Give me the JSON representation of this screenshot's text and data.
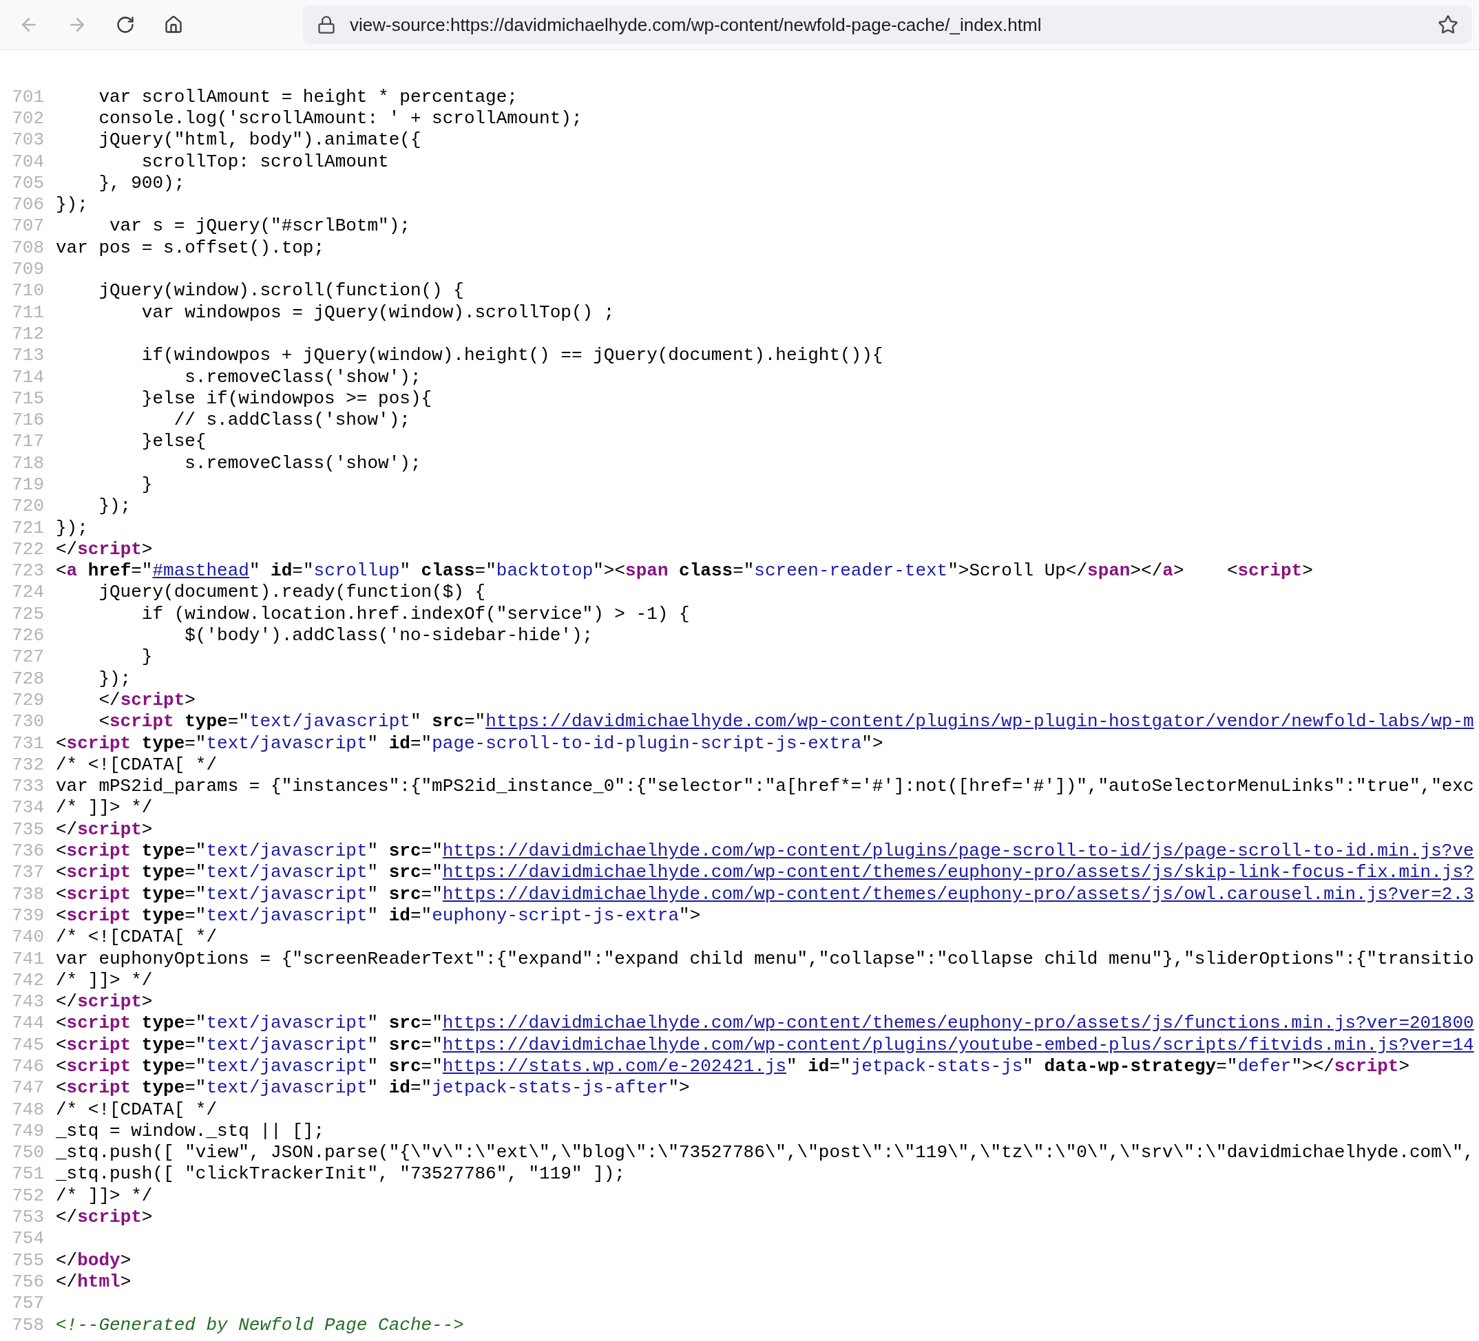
{
  "toolbar": {
    "buttons": [
      {
        "kind": "back",
        "disabled": true
      },
      {
        "kind": "forward",
        "disabled": true
      },
      {
        "kind": "reload",
        "disabled": false
      },
      {
        "kind": "home",
        "disabled": false
      }
    ],
    "address": "view-source:https://davidmichaelhyde.com/wp-content/newfold-page-cache/_index.html"
  },
  "lines": [
    {
      "number": "701",
      "text": "    var scrollAmount = height * percentage;"
    },
    {
      "number": "702",
      "text": "    console.log('scrollAmount: ' + scrollAmount);"
    },
    {
      "number": "703",
      "text": "    jQuery(\"html, body\").animate({"
    },
    {
      "number": "704",
      "text": "        scrollTop: scrollAmount"
    },
    {
      "number": "705",
      "text": "    }, 900);"
    },
    {
      "number": "706",
      "text": "});"
    },
    {
      "number": "707",
      "text": "     var s = jQuery(\"#scrlBotm\");"
    },
    {
      "number": "708",
      "text": "var pos = s.offset().top;"
    },
    {
      "number": "709"
    },
    {
      "number": "710",
      "text": "    jQuery(window).scroll(function() {"
    },
    {
      "number": "711",
      "text": "        var windowpos = jQuery(window).scrollTop() ;"
    },
    {
      "number": "712"
    },
    {
      "number": "713",
      "text": "        if(windowpos + jQuery(window).height() == jQuery(document).height()){"
    },
    {
      "number": "714",
      "text": "            s.removeClass('show');"
    },
    {
      "number": "715",
      "text": "        }else if(windowpos >= pos){"
    },
    {
      "number": "716",
      "text": "           // s.addClass('show');"
    },
    {
      "number": "717",
      "text": "        }else{"
    },
    {
      "number": "718",
      "text": "            s.removeClass('show');"
    },
    {
      "number": "719",
      "text": "        }"
    },
    {
      "number": "720",
      "text": "    });"
    },
    {
      "number": "721",
      "text": "});"
    },
    {
      "number": "722",
      "tokens": [
        {
          "kind": "text",
          "text": "</"
        },
        {
          "kind": "tag",
          "text": "script"
        },
        {
          "kind": "text",
          "text": ">"
        }
      ]
    },
    {
      "number": "723",
      "tokens": [
        {
          "kind": "text",
          "text": "<"
        },
        {
          "kind": "tag",
          "text": "a"
        },
        {
          "kind": "attr",
          "text": " href"
        },
        {
          "kind": "text",
          "text": "=\""
        },
        {
          "kind": "link",
          "text": "#masthead"
        },
        {
          "kind": "text",
          "text": "\" "
        },
        {
          "kind": "attr",
          "text": "id"
        },
        {
          "kind": "text",
          "text": "=\""
        },
        {
          "kind": "value",
          "text": "scrollup"
        },
        {
          "kind": "text",
          "text": "\" "
        },
        {
          "kind": "attr",
          "text": "class"
        },
        {
          "kind": "text",
          "text": "=\""
        },
        {
          "kind": "value",
          "text": "backtotop"
        },
        {
          "kind": "text",
          "text": "\"><"
        },
        {
          "kind": "tag",
          "text": "span"
        },
        {
          "kind": "attr",
          "text": " class"
        },
        {
          "kind": "text",
          "text": "=\""
        },
        {
          "kind": "value",
          "text": "screen-reader-text"
        },
        {
          "kind": "text",
          "text": "\">Scroll Up</"
        },
        {
          "kind": "tag",
          "text": "span"
        },
        {
          "kind": "text",
          "text": "></"
        },
        {
          "kind": "tag",
          "text": "a"
        },
        {
          "kind": "text",
          "text": ">    <"
        },
        {
          "kind": "tag",
          "text": "script"
        },
        {
          "kind": "text",
          "text": ">"
        }
      ]
    },
    {
      "number": "724",
      "text": "    jQuery(document).ready(function($) {"
    },
    {
      "number": "725",
      "text": "        if (window.location.href.indexOf(\"service\") > -1) {"
    },
    {
      "number": "726",
      "text": "            $('body').addClass('no-sidebar-hide');"
    },
    {
      "number": "727",
      "text": "        }"
    },
    {
      "number": "728",
      "text": "    });"
    },
    {
      "number": "729",
      "tokens": [
        {
          "kind": "text",
          "text": "    </"
        },
        {
          "kind": "tag",
          "text": "script"
        },
        {
          "kind": "text",
          "text": ">"
        }
      ]
    },
    {
      "number": "730",
      "tokens": [
        {
          "kind": "text",
          "text": "    <"
        },
        {
          "kind": "tag",
          "text": "script"
        },
        {
          "kind": "attr",
          "text": " type"
        },
        {
          "kind": "text",
          "text": "=\""
        },
        {
          "kind": "value",
          "text": "text/javascript"
        },
        {
          "kind": "text",
          "text": "\" "
        },
        {
          "kind": "attr",
          "text": "src"
        },
        {
          "kind": "text",
          "text": "=\""
        },
        {
          "kind": "link",
          "text": "https://davidmichaelhyde.com/wp-content/plugins/wp-plugin-hostgator/vendor/newfold-labs/wp-m"
        }
      ]
    },
    {
      "number": "731",
      "tokens": [
        {
          "kind": "text",
          "text": "<"
        },
        {
          "kind": "tag",
          "text": "script"
        },
        {
          "kind": "attr",
          "text": " type"
        },
        {
          "kind": "text",
          "text": "=\""
        },
        {
          "kind": "value",
          "text": "text/javascript"
        },
        {
          "kind": "text",
          "text": "\" "
        },
        {
          "kind": "attr",
          "text": "id"
        },
        {
          "kind": "text",
          "text": "=\""
        },
        {
          "kind": "value",
          "text": "page-scroll-to-id-plugin-script-js-extra"
        },
        {
          "kind": "text",
          "text": "\">"
        }
      ]
    },
    {
      "number": "732",
      "text": "/* <![CDATA[ */"
    },
    {
      "number": "733",
      "text": "var mPS2id_params = {\"instances\":{\"mPS2id_instance_0\":{\"selector\":\"a[href*='#']:not([href='#'])\",\"autoSelectorMenuLinks\":\"true\",\"exc"
    },
    {
      "number": "734",
      "text": "/* ]]> */"
    },
    {
      "number": "735",
      "tokens": [
        {
          "kind": "text",
          "text": "</"
        },
        {
          "kind": "tag",
          "text": "script"
        },
        {
          "kind": "text",
          "text": ">"
        }
      ]
    },
    {
      "number": "736",
      "tokens": [
        {
          "kind": "text",
          "text": "<"
        },
        {
          "kind": "tag",
          "text": "script"
        },
        {
          "kind": "attr",
          "text": " type"
        },
        {
          "kind": "text",
          "text": "=\""
        },
        {
          "kind": "value",
          "text": "text/javascript"
        },
        {
          "kind": "text",
          "text": "\" "
        },
        {
          "kind": "attr",
          "text": "src"
        },
        {
          "kind": "text",
          "text": "=\""
        },
        {
          "kind": "link",
          "text": "https://davidmichaelhyde.com/wp-content/plugins/page-scroll-to-id/js/page-scroll-to-id.min.js?ve"
        }
      ]
    },
    {
      "number": "737",
      "tokens": [
        {
          "kind": "text",
          "text": "<"
        },
        {
          "kind": "tag",
          "text": "script"
        },
        {
          "kind": "attr",
          "text": " type"
        },
        {
          "kind": "text",
          "text": "=\""
        },
        {
          "kind": "value",
          "text": "text/javascript"
        },
        {
          "kind": "text",
          "text": "\" "
        },
        {
          "kind": "attr",
          "text": "src"
        },
        {
          "kind": "text",
          "text": "=\""
        },
        {
          "kind": "link",
          "text": "https://davidmichaelhyde.com/wp-content/themes/euphony-pro/assets/js/skip-link-focus-fix.min.js?"
        }
      ]
    },
    {
      "number": "738",
      "tokens": [
        {
          "kind": "text",
          "text": "<"
        },
        {
          "kind": "tag",
          "text": "script"
        },
        {
          "kind": "attr",
          "text": " type"
        },
        {
          "kind": "text",
          "text": "=\""
        },
        {
          "kind": "value",
          "text": "text/javascript"
        },
        {
          "kind": "text",
          "text": "\" "
        },
        {
          "kind": "attr",
          "text": "src"
        },
        {
          "kind": "text",
          "text": "=\""
        },
        {
          "kind": "link",
          "text": "https://davidmichaelhyde.com/wp-content/themes/euphony-pro/assets/js/owl.carousel.min.js?ver=2.3"
        }
      ]
    },
    {
      "number": "739",
      "tokens": [
        {
          "kind": "text",
          "text": "<"
        },
        {
          "kind": "tag",
          "text": "script"
        },
        {
          "kind": "attr",
          "text": " type"
        },
        {
          "kind": "text",
          "text": "=\""
        },
        {
          "kind": "value",
          "text": "text/javascript"
        },
        {
          "kind": "text",
          "text": "\" "
        },
        {
          "kind": "attr",
          "text": "id"
        },
        {
          "kind": "text",
          "text": "=\""
        },
        {
          "kind": "value",
          "text": "euphony-script-js-extra"
        },
        {
          "kind": "text",
          "text": "\">"
        }
      ]
    },
    {
      "number": "740",
      "text": "/* <![CDATA[ */"
    },
    {
      "number": "741",
      "text": "var euphonyOptions = {\"screenReaderText\":{\"expand\":\"expand child menu\",\"collapse\":\"collapse child menu\"},\"sliderOptions\":{\"transitio"
    },
    {
      "number": "742",
      "text": "/* ]]> */"
    },
    {
      "number": "743",
      "tokens": [
        {
          "kind": "text",
          "text": "</"
        },
        {
          "kind": "tag",
          "text": "script"
        },
        {
          "kind": "text",
          "text": ">"
        }
      ]
    },
    {
      "number": "744",
      "tokens": [
        {
          "kind": "text",
          "text": "<"
        },
        {
          "kind": "tag",
          "text": "script"
        },
        {
          "kind": "attr",
          "text": " type"
        },
        {
          "kind": "text",
          "text": "=\""
        },
        {
          "kind": "value",
          "text": "text/javascript"
        },
        {
          "kind": "text",
          "text": "\" "
        },
        {
          "kind": "attr",
          "text": "src"
        },
        {
          "kind": "text",
          "text": "=\""
        },
        {
          "kind": "link",
          "text": "https://davidmichaelhyde.com/wp-content/themes/euphony-pro/assets/js/functions.min.js?ver=201800"
        }
      ]
    },
    {
      "number": "745",
      "tokens": [
        {
          "kind": "text",
          "text": "<"
        },
        {
          "kind": "tag",
          "text": "script"
        },
        {
          "kind": "attr",
          "text": " type"
        },
        {
          "kind": "text",
          "text": "=\""
        },
        {
          "kind": "value",
          "text": "text/javascript"
        },
        {
          "kind": "text",
          "text": "\" "
        },
        {
          "kind": "attr",
          "text": "src"
        },
        {
          "kind": "text",
          "text": "=\""
        },
        {
          "kind": "link",
          "text": "https://davidmichaelhyde.com/wp-content/plugins/youtube-embed-plus/scripts/fitvids.min.js?ver=14"
        }
      ]
    },
    {
      "number": "746",
      "tokens": [
        {
          "kind": "text",
          "text": "<"
        },
        {
          "kind": "tag",
          "text": "script"
        },
        {
          "kind": "attr",
          "text": " type"
        },
        {
          "kind": "text",
          "text": "=\""
        },
        {
          "kind": "value",
          "text": "text/javascript"
        },
        {
          "kind": "text",
          "text": "\" "
        },
        {
          "kind": "attr",
          "text": "src"
        },
        {
          "kind": "text",
          "text": "=\""
        },
        {
          "kind": "link",
          "text": "https://stats.wp.com/e-202421.js"
        },
        {
          "kind": "text",
          "text": "\" "
        },
        {
          "kind": "attr",
          "text": "id"
        },
        {
          "kind": "text",
          "text": "=\""
        },
        {
          "kind": "value",
          "text": "jetpack-stats-js"
        },
        {
          "kind": "text",
          "text": "\" "
        },
        {
          "kind": "attr",
          "text": "data-wp-strategy"
        },
        {
          "kind": "text",
          "text": "=\""
        },
        {
          "kind": "value",
          "text": "defer"
        },
        {
          "kind": "text",
          "text": "\"></"
        },
        {
          "kind": "tag",
          "text": "script"
        },
        {
          "kind": "text",
          "text": ">"
        }
      ]
    },
    {
      "number": "747",
      "tokens": [
        {
          "kind": "text",
          "text": "<"
        },
        {
          "kind": "tag",
          "text": "script"
        },
        {
          "kind": "attr",
          "text": " type"
        },
        {
          "kind": "text",
          "text": "=\""
        },
        {
          "kind": "value",
          "text": "text/javascript"
        },
        {
          "kind": "text",
          "text": "\" "
        },
        {
          "kind": "attr",
          "text": "id"
        },
        {
          "kind": "text",
          "text": "=\""
        },
        {
          "kind": "value",
          "text": "jetpack-stats-js-after"
        },
        {
          "kind": "text",
          "text": "\">"
        }
      ]
    },
    {
      "number": "748",
      "text": "/* <![CDATA[ */"
    },
    {
      "number": "749",
      "text": "_stq = window._stq || [];"
    },
    {
      "number": "750",
      "text": "_stq.push([ \"view\", JSON.parse(\"{\\\"v\\\":\\\"ext\\\",\\\"blog\\\":\\\"73527786\\\",\\\"post\\\":\\\"119\\\",\\\"tz\\\":\\\"0\\\",\\\"srv\\\":\\\"davidmichaelhyde.com\\\","
    },
    {
      "number": "751",
      "text": "_stq.push([ \"clickTrackerInit\", \"73527786\", \"119\" ]);"
    },
    {
      "number": "752",
      "text": "/* ]]> */"
    },
    {
      "number": "753",
      "tokens": [
        {
          "kind": "text",
          "text": "</"
        },
        {
          "kind": "tag",
          "text": "script"
        },
        {
          "kind": "text",
          "text": ">"
        }
      ]
    },
    {
      "number": "754"
    },
    {
      "number": "755",
      "tokens": [
        {
          "kind": "text",
          "text": "</"
        },
        {
          "kind": "tag",
          "text": "body"
        },
        {
          "kind": "text",
          "text": ">"
        }
      ]
    },
    {
      "number": "756",
      "tokens": [
        {
          "kind": "text",
          "text": "</"
        },
        {
          "kind": "tag",
          "text": "html"
        },
        {
          "kind": "text",
          "text": ">"
        }
      ]
    },
    {
      "number": "757"
    },
    {
      "number": "758",
      "tokens": [
        {
          "kind": "comment",
          "text": "<!--Generated by Newfold Page Cache-->"
        }
      ]
    }
  ]
}
